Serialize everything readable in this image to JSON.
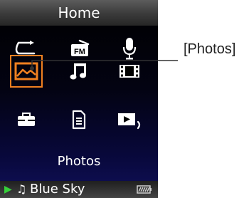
{
  "header": {
    "title": "Home"
  },
  "grid": {
    "items": [
      {
        "icon": "shuffle-icon",
        "label": "Shuffle"
      },
      {
        "icon": "fm-radio-icon",
        "label": "FM"
      },
      {
        "icon": "microphone-icon",
        "label": "Voice"
      },
      {
        "icon": "photos-icon",
        "label": "Photos",
        "selected": true
      },
      {
        "icon": "music-note-icon",
        "label": "Music"
      },
      {
        "icon": "video-film-icon",
        "label": "Videos"
      },
      {
        "icon": "settings-toolbox-icon",
        "label": "Settings"
      },
      {
        "icon": "document-icon",
        "label": "Documents"
      },
      {
        "icon": "now-playing-icon",
        "label": "Now Playing"
      }
    ],
    "fm_text": "FM"
  },
  "selected_label": "Photos",
  "now_playing": {
    "title": "Blue Sky"
  },
  "callout": {
    "text": "[Photos]"
  },
  "colors": {
    "highlight": "#f08020",
    "play": "#36d13a",
    "icon": "#ffffff"
  }
}
